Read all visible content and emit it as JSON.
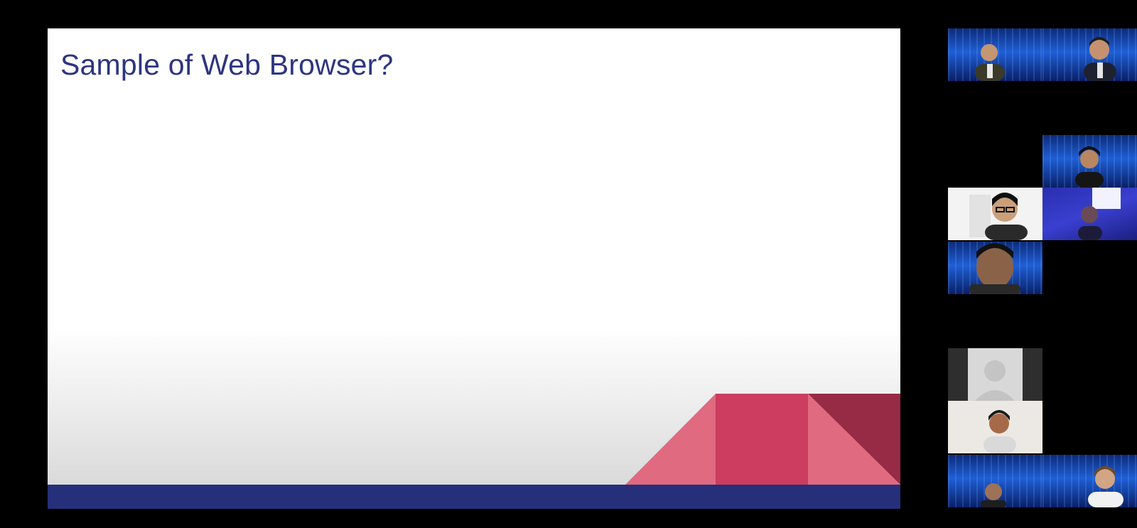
{
  "slide": {
    "title": "Sample of Web Browser?",
    "colors": {
      "title": "#2e3580",
      "footer_bar": "#262f7a",
      "shape_light": "#e06a80",
      "shape_mid": "#cc3d5f",
      "shape_dark": "#972a45"
    }
  },
  "participants": [
    {
      "icon": "person-video-icon",
      "background": "virtual-blue"
    },
    {
      "icon": "person-video-icon",
      "background": "virtual-blue"
    },
    {
      "icon": "person-video-icon",
      "background": "virtual-blue"
    },
    {
      "icon": "person-video-icon",
      "background": "white-room"
    },
    {
      "icon": "person-video-icon",
      "background": "purple-room"
    },
    {
      "icon": "person-video-icon",
      "background": "virtual-blue"
    },
    {
      "icon": "default-avatar-icon",
      "background": "camera-off"
    },
    {
      "icon": "person-video-icon",
      "background": "beige-room"
    },
    {
      "icon": "person-video-icon",
      "background": "virtual-blue"
    },
    {
      "icon": "person-video-icon",
      "background": "virtual-blue"
    }
  ]
}
